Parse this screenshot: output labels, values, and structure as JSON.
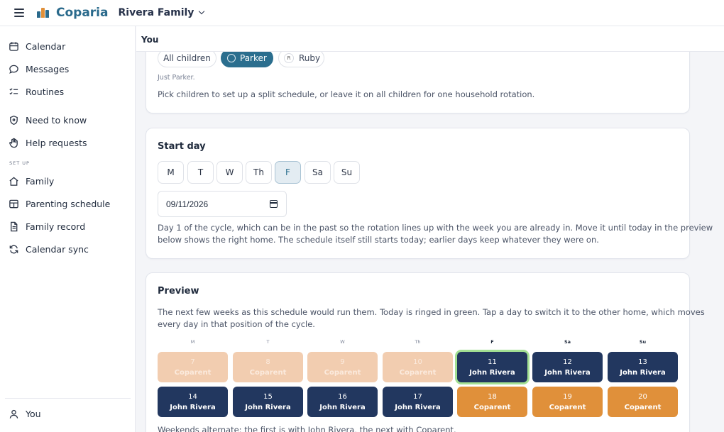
{
  "app": {
    "brand": "Coparia",
    "family": "Rivera Family"
  },
  "header": {
    "title": "You"
  },
  "sidebar": {
    "items": [
      {
        "label": "Calendar",
        "icon": "calendar-icon"
      },
      {
        "label": "Messages",
        "icon": "chat-bubble-icon"
      },
      {
        "label": "Routines",
        "icon": "checklist-icon"
      },
      {
        "label": "Need to know",
        "icon": "shield-icon"
      },
      {
        "label": "Help requests",
        "icon": "hand-icon"
      }
    ],
    "setup_label": "SET UP",
    "setup_items": [
      {
        "label": "Family",
        "icon": "home-icon"
      },
      {
        "label": "Parenting schedule",
        "icon": "schedule-grid-icon"
      },
      {
        "label": "Family record",
        "icon": "document-icon"
      },
      {
        "label": "Calendar sync",
        "icon": "sync-icon"
      }
    ],
    "footer": {
      "label": "You",
      "icon": "user-icon"
    }
  },
  "children": {
    "chips": [
      {
        "label": "All children",
        "selected": false
      },
      {
        "label": "Parker",
        "selected": true
      },
      {
        "label": "Ruby",
        "initial": "R",
        "selected": false
      }
    ],
    "status": "Just Parker.",
    "help": "Pick children to set up a split schedule, or leave it on all children for one household rotation."
  },
  "start_day": {
    "title": "Start day",
    "days": [
      "M",
      "T",
      "W",
      "Th",
      "F",
      "Sa",
      "Su"
    ],
    "selected_day": "F",
    "date_value": "09/11/2026",
    "help_line1": "Day 1 of the cycle, which can be in the past so the rotation lines up with the week you are already in. Move it until today in the preview",
    "help_line2": "below shows the right home. The schedule itself still starts today; earlier days keep whatever they were on."
  },
  "preview": {
    "title": "Preview",
    "help_line1": "The next few weeks as this schedule would run them. Today is ringed in green. Tap a day to switch it to the other home, which moves",
    "help_line2": "every day in that position of the cycle.",
    "weekdays": [
      "M",
      "T",
      "W",
      "Th",
      "F",
      "Sa",
      "Su"
    ],
    "weeks": [
      [
        {
          "day": "7",
          "who": "Coparent",
          "state": "past"
        },
        {
          "day": "8",
          "who": "Coparent",
          "state": "past"
        },
        {
          "day": "9",
          "who": "Coparent",
          "state": "past"
        },
        {
          "day": "10",
          "who": "Coparent",
          "state": "past"
        },
        {
          "day": "11",
          "who": "John Rivera",
          "state": "today"
        },
        {
          "day": "12",
          "who": "John Rivera",
          "state": "john"
        },
        {
          "day": "13",
          "who": "John Rivera",
          "state": "john"
        }
      ],
      [
        {
          "day": "14",
          "who": "John Rivera",
          "state": "john"
        },
        {
          "day": "15",
          "who": "John Rivera",
          "state": "john"
        },
        {
          "day": "16",
          "who": "John Rivera",
          "state": "john"
        },
        {
          "day": "17",
          "who": "John Rivera",
          "state": "john"
        },
        {
          "day": "18",
          "who": "Coparent",
          "state": "coparent"
        },
        {
          "day": "19",
          "who": "Coparent",
          "state": "coparent"
        },
        {
          "day": "20",
          "who": "Coparent",
          "state": "coparent"
        }
      ]
    ],
    "summary": "Weekends alternate: the first is with John Rivera, the next with Coparent."
  },
  "colors": {
    "brand": "#2a6a8c",
    "john": "#22375f",
    "coparent": "#e0903a",
    "past": "#f2cdb0",
    "today_ring": "#a3e093"
  }
}
